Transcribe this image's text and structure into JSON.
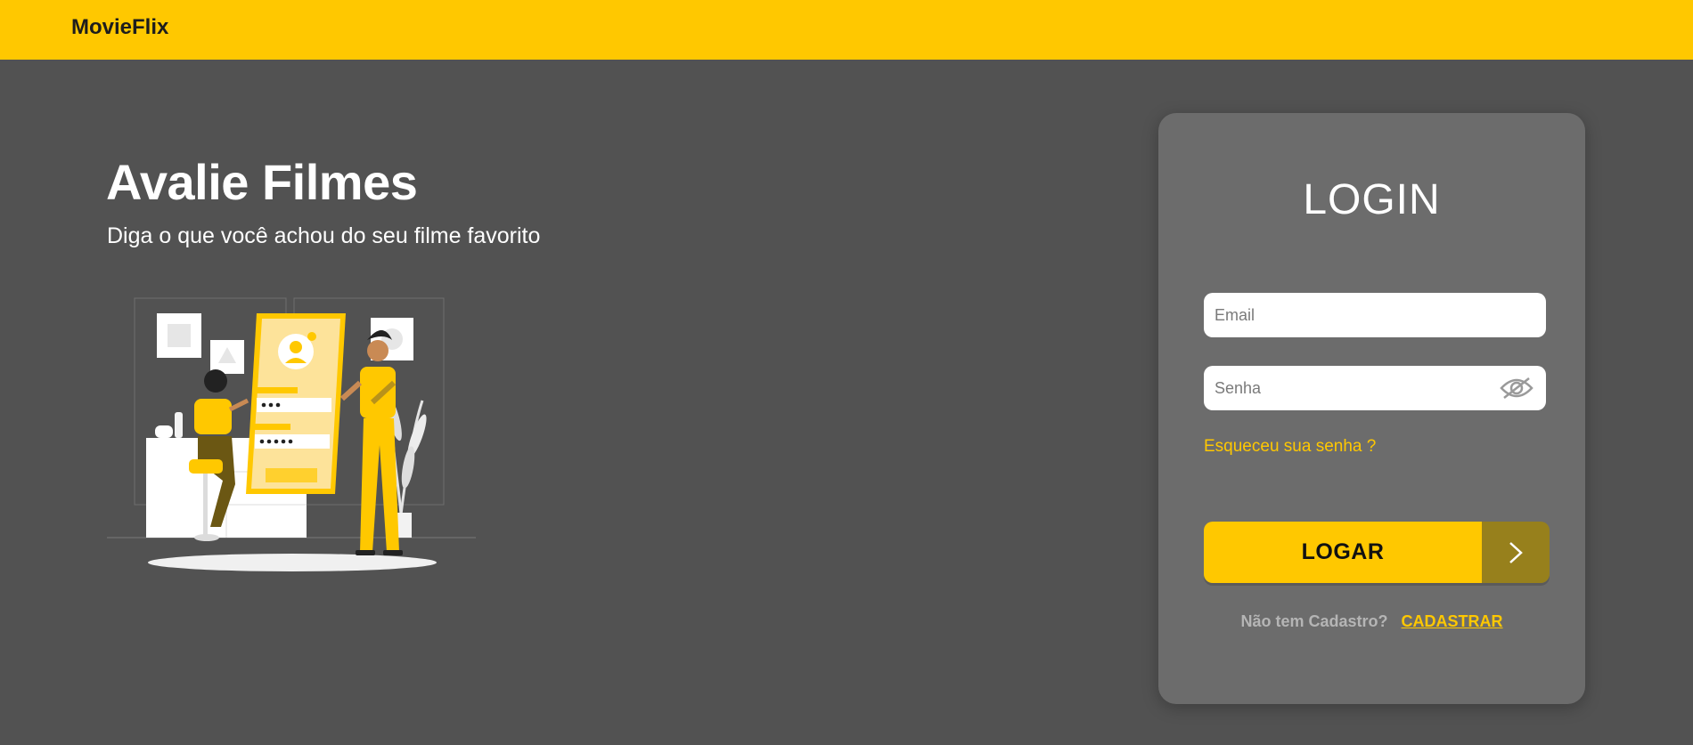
{
  "navbar": {
    "brand": "MovieFlix",
    "color": "#FFC800"
  },
  "hero": {
    "title": "Avalie Filmes",
    "subtitle": "Diga o que você achou do seu filme favorito",
    "illustration_icon": "login-illustration"
  },
  "login": {
    "title": "LOGIN",
    "email_placeholder": "Email",
    "email_value": "",
    "password_placeholder": "Senha",
    "password_value": "",
    "password_toggle_icon": "eye-icon",
    "forgot_link": "Esqueceu sua senha ?",
    "submit_label": "LOGAR",
    "submit_arrow_icon": "chevron-right-icon",
    "signup_question": "Não tem Cadastro?",
    "signup_link": "CADASTRAR"
  },
  "colors": {
    "accent": "#FFC800",
    "accent_dark": "#97801C",
    "background": "#525252",
    "card": "#6C6C6C"
  }
}
